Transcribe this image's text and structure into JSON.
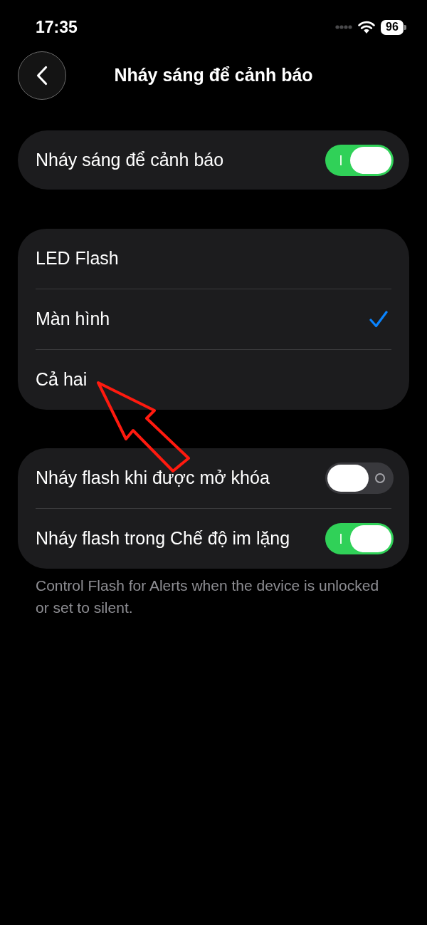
{
  "status_bar": {
    "time": "17:35",
    "battery": "96"
  },
  "header": {
    "title": "Nháy sáng để cảnh báo"
  },
  "main_toggle": {
    "label": "Nháy sáng để cảnh báo",
    "on": true
  },
  "flash_options": [
    {
      "label": "LED Flash",
      "selected": false
    },
    {
      "label": "Màn hình",
      "selected": true
    },
    {
      "label": "Cả hai",
      "selected": false
    }
  ],
  "conditions": [
    {
      "label": "Nháy flash khi được mở khóa",
      "on": false
    },
    {
      "label": "Nháy flash trong Chế độ im lặng",
      "on": true
    }
  ],
  "footer_note": "Control Flash for Alerts when the device is unlocked or set to silent.",
  "annotations": [
    {
      "kind": "arrow"
    }
  ]
}
